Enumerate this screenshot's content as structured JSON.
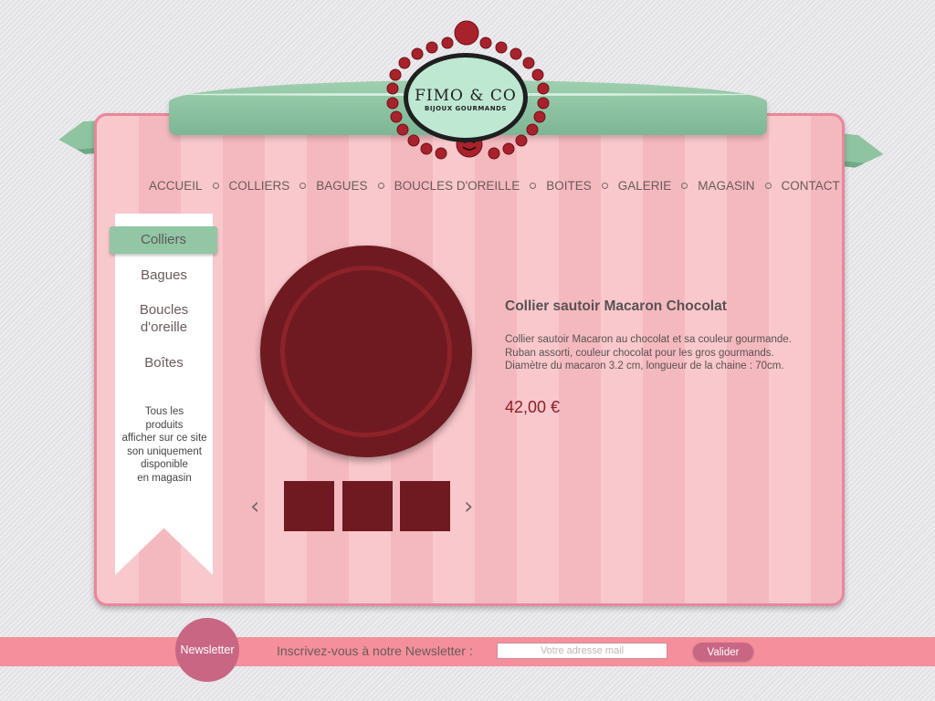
{
  "logo": {
    "title": "FIMO & CO",
    "subtitle": "BIJOUX GOURMANDS"
  },
  "nav": [
    "ACCUEIL",
    "COLLIERS",
    "BAGUES",
    "BOUCLES D'OREILLE",
    "BOITES",
    "GALERIE",
    "MAGASIN",
    "CONTACT"
  ],
  "sidebar": {
    "active": "Colliers",
    "items": [
      "Bagues",
      "Boucles\nd'oreille",
      "Boîtes"
    ],
    "note": "Tous les\nproduits\nafficher sur ce site\nson uniquement\ndisponible\nen magasin"
  },
  "product": {
    "title": "Collier sautoir Macaron Chocolat",
    "description": "Collier sautoir Macaron au chocolat et sa couleur gourmande.\nRuban assorti, couleur chocolat pour les gros gourmands.\nDiamètre du macaron 3.2 cm, longueur de la chaine : 70cm.",
    "price": "42,00 €"
  },
  "gallery": {
    "prev": "‹",
    "next": "›",
    "thumb_count": 3
  },
  "newsletter": {
    "badge": "Newsletter",
    "label": "Inscrivez-vous à notre Newsletter :",
    "placeholder": "Votre adresse mail",
    "button": "Valider"
  },
  "colors": {
    "accent": "#8ec4a1",
    "pink": "#f58f9c",
    "chocolate": "#6e1a20",
    "button": "#c96684"
  }
}
